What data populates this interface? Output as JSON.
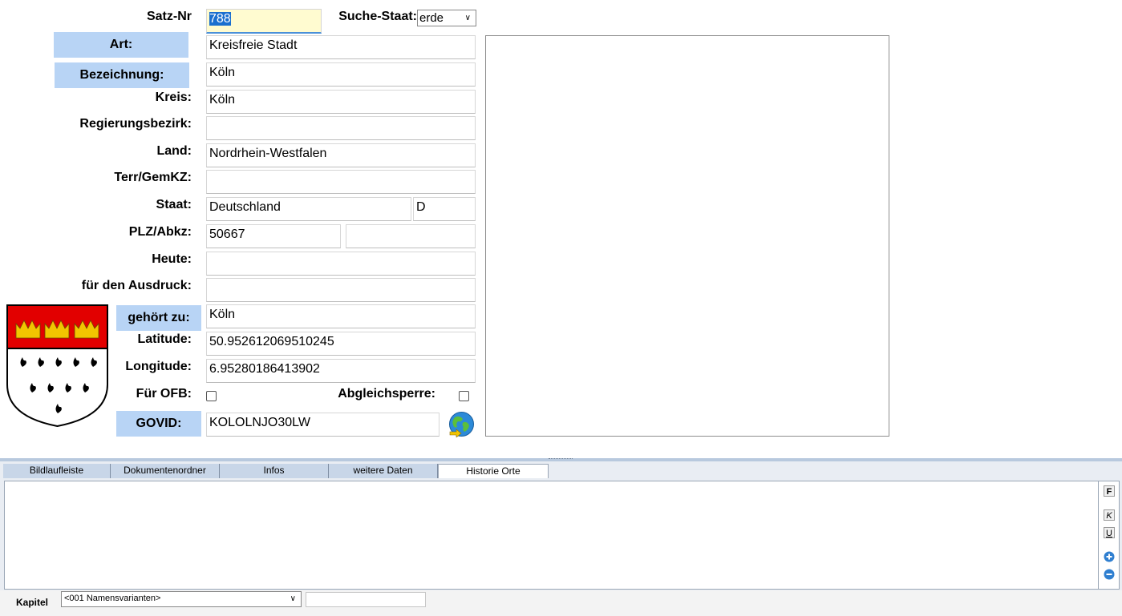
{
  "form": {
    "satz_nr_label": "Satz-Nr",
    "satz_nr_value": "788",
    "suche_staat_label": "Suche-Staat:",
    "suche_staat_value": "erde",
    "art_label": "Art:",
    "art_value": "Kreisfreie Stadt",
    "bezeichnung_label": "Bezeichnung:",
    "bezeichnung_value": "Köln",
    "kreis_label": "Kreis:",
    "kreis_value": "Köln",
    "regierungsbezirk_label": "Regierungsbezirk:",
    "regierungsbezirk_value": "",
    "land_label": "Land:",
    "land_value": "Nordrhein-Westfalen",
    "terr_label": "Terr/GemKZ:",
    "terr_value": "",
    "staat_label": "Staat:",
    "staat_value": "Deutschland",
    "staat_code": "D",
    "plz_label": "PLZ/Abkz:",
    "plz_value": "50667",
    "abkz_value": "",
    "heute_label": "Heute:",
    "heute_value": "",
    "ausdruck_label": "für den Ausdruck:",
    "ausdruck_value": "",
    "gehoert_label": "gehört zu:",
    "gehoert_value": "Köln",
    "latitude_label": "Latitude:",
    "latitude_value": "50.952612069510245",
    "longitude_label": "Longitude:",
    "longitude_value": "6.95280186413902",
    "ofb_label": "Für OFB:",
    "abgleich_label": "Abgleichsperre:",
    "govid_label": "GOVID:",
    "govid_value": "KOLOLNJO30LW"
  },
  "colors": {
    "label_button_bg": "#b8d4f5",
    "coat_red": "#e20000",
    "coat_gold": "#f2c500"
  },
  "tabs": [
    {
      "label": "Bildlaufleiste"
    },
    {
      "label": "Dokumentenordner"
    },
    {
      "label": "Infos"
    },
    {
      "label": "weitere Daten"
    },
    {
      "label": "Historie Orte",
      "active": true
    }
  ],
  "editor": {
    "bold_btn": "F",
    "italic_btn": "K",
    "underline_btn": "U"
  },
  "footer": {
    "kapitel_label": "Kapitel",
    "kapitel_value": "<001 Namensvarianten>",
    "extra_value": ""
  },
  "icons": {
    "globe": "globe-icon",
    "coat_of_arms": "coat-of-arms-icon"
  }
}
